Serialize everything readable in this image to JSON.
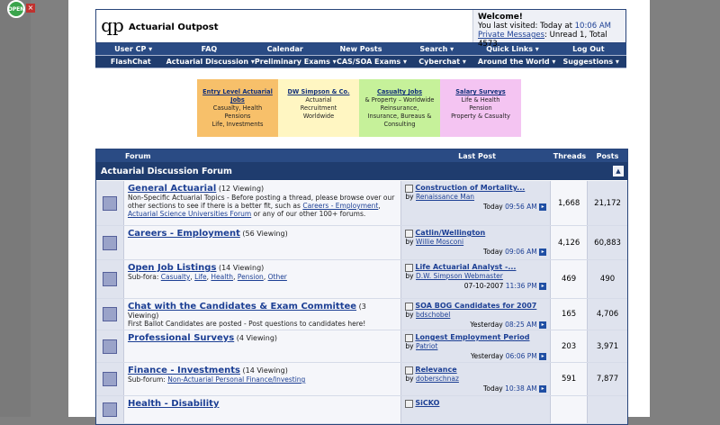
{
  "site": {
    "title": "Actuarial Outpost",
    "logo": "qp"
  },
  "browser": {
    "open_label": "OPEN",
    "close_label": "×"
  },
  "welcome": {
    "heading": "Welcome!",
    "last_visited": "You last visited: Today at",
    "last_time": "10:06 AM",
    "pm_link": "Private Messages",
    "pm_counts": ": Unread 1, Total 4573."
  },
  "nav1": [
    "User CP ▾",
    "FAQ",
    "Calendar",
    "New Posts",
    "Search ▾",
    "Quick Links ▾",
    "Log Out"
  ],
  "nav2": [
    "FlashChat",
    "Actuarial Discussion ▾",
    "Preliminary Exams ▾",
    "CAS/SOA Exams ▾",
    "Cyberchat ▾",
    "Around the World ▾",
    "Suggestions ▾"
  ],
  "ads": [
    {
      "title": "Entry Level Actuarial Jobs",
      "lines": [
        "Casualty, Health",
        "Pensions",
        "",
        "Life, Investments"
      ],
      "color": "#f7c06a"
    },
    {
      "title": "DW Simpson & Co.",
      "lines": [
        "Actuarial",
        "Recruitment",
        "Worldwide"
      ],
      "color": "#fff6c2"
    },
    {
      "title": "Casualty Jobs",
      "lines": [
        "& Property – Worldwide",
        "Reinsurance,",
        "Insurance, Bureaus &",
        "Consulting"
      ],
      "color": "#c6f19a"
    },
    {
      "title": "Salary Surveys",
      "lines": [
        "Life & Health",
        "Pension",
        "Property & Casualty"
      ],
      "color": "#f4c4f2"
    }
  ],
  "table": {
    "headers": {
      "forum": "Forum",
      "last_post": "Last Post",
      "threads": "Threads",
      "posts": "Posts"
    },
    "category": "Actuarial Discussion Forum",
    "collapse_icon": "▲",
    "rows": [
      {
        "name": "General Actuarial",
        "viewing": "(12 Viewing)",
        "desc": "Non-Specific Actuarial Topics - Before posting a thread, please browse over our other sections to see if there is a better fit, such as",
        "links": [
          "Careers - Employment",
          "Actuarial Science Universities Forum"
        ],
        "desc_tail": "or any of our other 100+ forums.",
        "lp_title": "Construction of Mortality...",
        "lp_by": "Renaissance Man",
        "lp_day": "Today",
        "lp_time": "09:56 AM",
        "threads": "1,668",
        "posts": "21,172"
      },
      {
        "name": "Careers - Employment",
        "viewing": "(56 Viewing)",
        "desc": "",
        "links": [],
        "desc_tail": "",
        "lp_title": "Catlin/Wellington",
        "lp_by": "Willie Mosconi",
        "lp_day": "Today",
        "lp_time": "09:06 AM",
        "threads": "4,126",
        "posts": "60,883"
      },
      {
        "name": "Open Job Listings",
        "viewing": "(14 Viewing)",
        "desc": "Sub-fora:",
        "links": [
          "Casualty",
          "Life",
          "Health",
          "Pension",
          "Other"
        ],
        "desc_tail": "",
        "lp_title": "Life Actuarial Analyst -...",
        "lp_by": "D.W. Simpson Webmaster",
        "lp_day": "07-10-2007",
        "lp_time": "11:36 PM",
        "threads": "469",
        "posts": "490"
      },
      {
        "name": "Chat with the Candidates & Exam Committee",
        "viewing": "(3 Viewing)",
        "desc": "First Ballot Candidates are posted - Post questions to candidates here!",
        "links": [],
        "desc_tail": "",
        "lp_title": "SOA BOG Candidates for 2007",
        "lp_by": "bdschobel",
        "lp_day": "Yesterday",
        "lp_time": "08:25 AM",
        "threads": "165",
        "posts": "4,706"
      },
      {
        "name": "Professional Surveys",
        "viewing": "(4 Viewing)",
        "desc": "",
        "links": [],
        "desc_tail": "",
        "lp_title": "Longest Employment Period",
        "lp_by": "Patriot",
        "lp_day": "Yesterday",
        "lp_time": "06:06 PM",
        "threads": "203",
        "posts": "3,971"
      },
      {
        "name": "Finance - Investments",
        "viewing": "(14 Viewing)",
        "desc": "Sub-forum:",
        "links": [
          "Non-Actuarial Personal Finance/Investing"
        ],
        "desc_tail": "",
        "lp_title": "Relevance",
        "lp_by": "doberschnaz",
        "lp_day": "Today",
        "lp_time": "10:38 AM",
        "threads": "591",
        "posts": "7,877"
      },
      {
        "name": "Health - Disability",
        "viewing": "",
        "desc": "",
        "links": [],
        "desc_tail": "",
        "lp_title": "SiCKO",
        "lp_by": "",
        "lp_day": "",
        "lp_time": "",
        "threads": "",
        "posts": ""
      }
    ]
  }
}
